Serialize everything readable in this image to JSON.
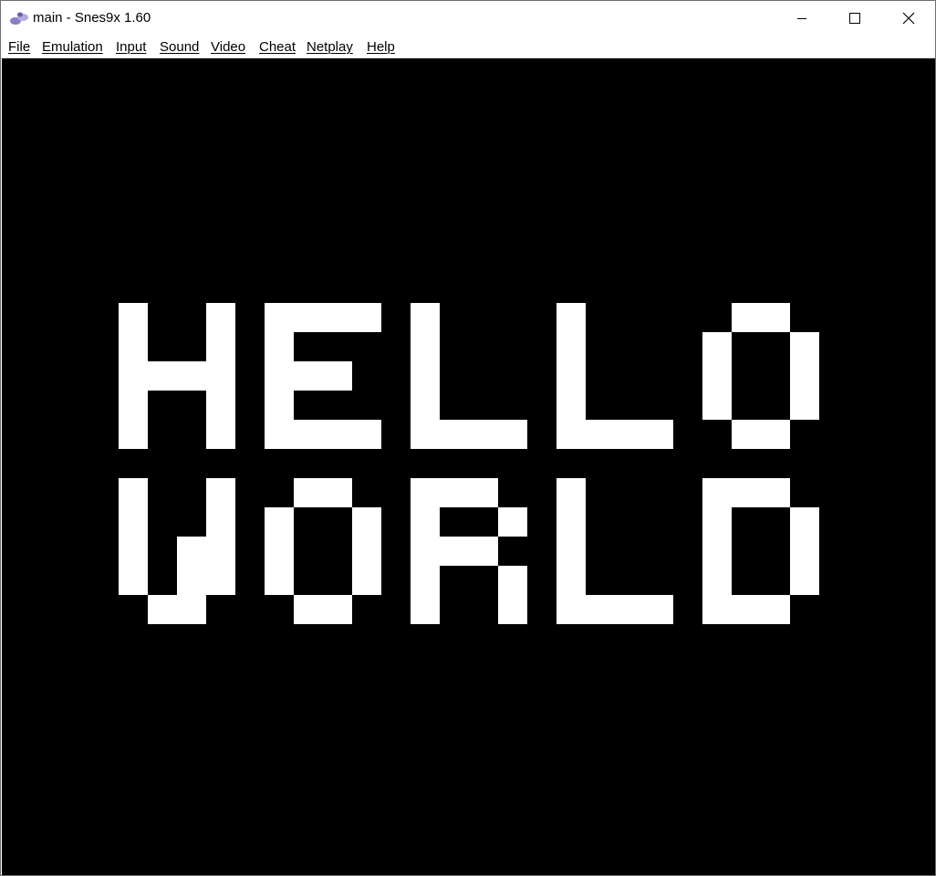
{
  "window": {
    "title": "main - Snes9x 1.60",
    "icon": "snes9x-app-icon",
    "controls": {
      "minimize": "minimize-icon",
      "maximize": "maximize-icon",
      "close": "close-icon"
    }
  },
  "menubar": {
    "items": [
      {
        "label": "File"
      },
      {
        "label": "Emulation"
      },
      {
        "label": "Input"
      },
      {
        "label": "Sound"
      },
      {
        "label": "Video"
      },
      {
        "label": "Cheat"
      },
      {
        "label": "Netplay"
      },
      {
        "label": "Help"
      }
    ]
  },
  "game": {
    "background": "#000000",
    "text_color": "#ffffff",
    "lines": [
      "HELLO",
      "WORLD"
    ]
  }
}
